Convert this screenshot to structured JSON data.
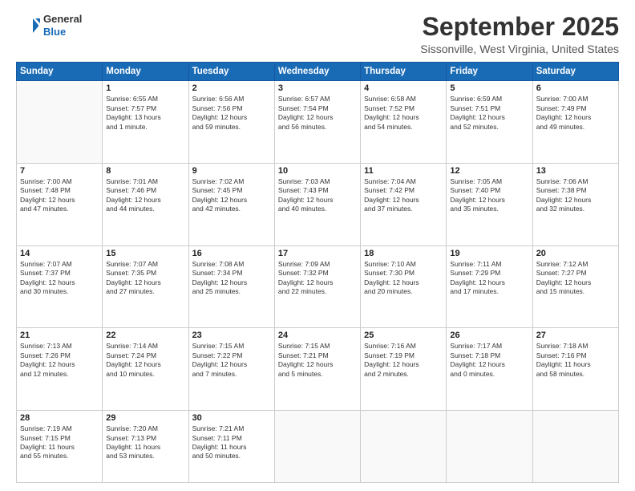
{
  "logo": {
    "line1": "General",
    "line2": "Blue"
  },
  "title": "September 2025",
  "location": "Sissonville, West Virginia, United States",
  "weekdays": [
    "Sunday",
    "Monday",
    "Tuesday",
    "Wednesday",
    "Thursday",
    "Friday",
    "Saturday"
  ],
  "weeks": [
    [
      {
        "day": "",
        "info": ""
      },
      {
        "day": "1",
        "info": "Sunrise: 6:55 AM\nSunset: 7:57 PM\nDaylight: 13 hours\nand 1 minute."
      },
      {
        "day": "2",
        "info": "Sunrise: 6:56 AM\nSunset: 7:56 PM\nDaylight: 12 hours\nand 59 minutes."
      },
      {
        "day": "3",
        "info": "Sunrise: 6:57 AM\nSunset: 7:54 PM\nDaylight: 12 hours\nand 56 minutes."
      },
      {
        "day": "4",
        "info": "Sunrise: 6:58 AM\nSunset: 7:52 PM\nDaylight: 12 hours\nand 54 minutes."
      },
      {
        "day": "5",
        "info": "Sunrise: 6:59 AM\nSunset: 7:51 PM\nDaylight: 12 hours\nand 52 minutes."
      },
      {
        "day": "6",
        "info": "Sunrise: 7:00 AM\nSunset: 7:49 PM\nDaylight: 12 hours\nand 49 minutes."
      }
    ],
    [
      {
        "day": "7",
        "info": "Sunrise: 7:00 AM\nSunset: 7:48 PM\nDaylight: 12 hours\nand 47 minutes."
      },
      {
        "day": "8",
        "info": "Sunrise: 7:01 AM\nSunset: 7:46 PM\nDaylight: 12 hours\nand 44 minutes."
      },
      {
        "day": "9",
        "info": "Sunrise: 7:02 AM\nSunset: 7:45 PM\nDaylight: 12 hours\nand 42 minutes."
      },
      {
        "day": "10",
        "info": "Sunrise: 7:03 AM\nSunset: 7:43 PM\nDaylight: 12 hours\nand 40 minutes."
      },
      {
        "day": "11",
        "info": "Sunrise: 7:04 AM\nSunset: 7:42 PM\nDaylight: 12 hours\nand 37 minutes."
      },
      {
        "day": "12",
        "info": "Sunrise: 7:05 AM\nSunset: 7:40 PM\nDaylight: 12 hours\nand 35 minutes."
      },
      {
        "day": "13",
        "info": "Sunrise: 7:06 AM\nSunset: 7:38 PM\nDaylight: 12 hours\nand 32 minutes."
      }
    ],
    [
      {
        "day": "14",
        "info": "Sunrise: 7:07 AM\nSunset: 7:37 PM\nDaylight: 12 hours\nand 30 minutes."
      },
      {
        "day": "15",
        "info": "Sunrise: 7:07 AM\nSunset: 7:35 PM\nDaylight: 12 hours\nand 27 minutes."
      },
      {
        "day": "16",
        "info": "Sunrise: 7:08 AM\nSunset: 7:34 PM\nDaylight: 12 hours\nand 25 minutes."
      },
      {
        "day": "17",
        "info": "Sunrise: 7:09 AM\nSunset: 7:32 PM\nDaylight: 12 hours\nand 22 minutes."
      },
      {
        "day": "18",
        "info": "Sunrise: 7:10 AM\nSunset: 7:30 PM\nDaylight: 12 hours\nand 20 minutes."
      },
      {
        "day": "19",
        "info": "Sunrise: 7:11 AM\nSunset: 7:29 PM\nDaylight: 12 hours\nand 17 minutes."
      },
      {
        "day": "20",
        "info": "Sunrise: 7:12 AM\nSunset: 7:27 PM\nDaylight: 12 hours\nand 15 minutes."
      }
    ],
    [
      {
        "day": "21",
        "info": "Sunrise: 7:13 AM\nSunset: 7:26 PM\nDaylight: 12 hours\nand 12 minutes."
      },
      {
        "day": "22",
        "info": "Sunrise: 7:14 AM\nSunset: 7:24 PM\nDaylight: 12 hours\nand 10 minutes."
      },
      {
        "day": "23",
        "info": "Sunrise: 7:15 AM\nSunset: 7:22 PM\nDaylight: 12 hours\nand 7 minutes."
      },
      {
        "day": "24",
        "info": "Sunrise: 7:15 AM\nSunset: 7:21 PM\nDaylight: 12 hours\nand 5 minutes."
      },
      {
        "day": "25",
        "info": "Sunrise: 7:16 AM\nSunset: 7:19 PM\nDaylight: 12 hours\nand 2 minutes."
      },
      {
        "day": "26",
        "info": "Sunrise: 7:17 AM\nSunset: 7:18 PM\nDaylight: 12 hours\nand 0 minutes."
      },
      {
        "day": "27",
        "info": "Sunrise: 7:18 AM\nSunset: 7:16 PM\nDaylight: 11 hours\nand 58 minutes."
      }
    ],
    [
      {
        "day": "28",
        "info": "Sunrise: 7:19 AM\nSunset: 7:15 PM\nDaylight: 11 hours\nand 55 minutes."
      },
      {
        "day": "29",
        "info": "Sunrise: 7:20 AM\nSunset: 7:13 PM\nDaylight: 11 hours\nand 53 minutes."
      },
      {
        "day": "30",
        "info": "Sunrise: 7:21 AM\nSunset: 7:11 PM\nDaylight: 11 hours\nand 50 minutes."
      },
      {
        "day": "",
        "info": ""
      },
      {
        "day": "",
        "info": ""
      },
      {
        "day": "",
        "info": ""
      },
      {
        "day": "",
        "info": ""
      }
    ]
  ]
}
